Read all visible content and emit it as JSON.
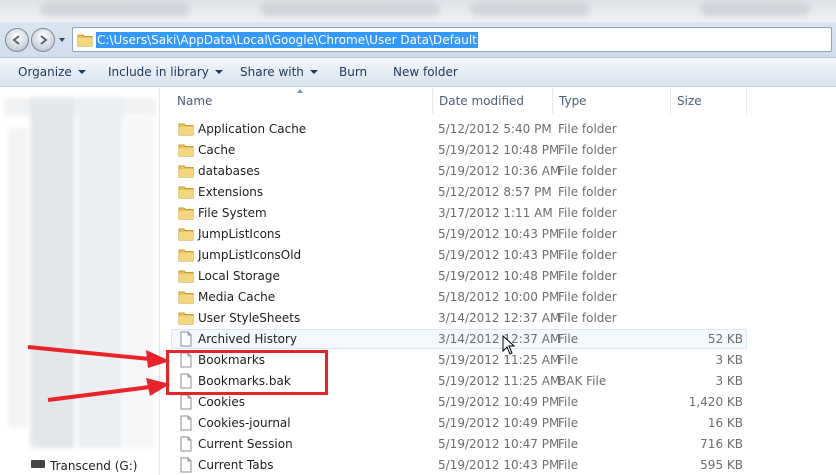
{
  "address_bar": {
    "path": "C:\\Users\\Saki\\AppData\\Local\\Google\\Chrome\\User Data\\Default"
  },
  "toolbar": {
    "organize": "Organize",
    "include_in_library": "Include in library",
    "share_with": "Share with",
    "burn": "Burn",
    "new_folder": "New folder"
  },
  "columns": {
    "name": "Name",
    "date_modified": "Date modified",
    "type": "Type",
    "size": "Size"
  },
  "nav_pane": {
    "drive_label": "Transcend (G:)"
  },
  "files": [
    {
      "name": "Application Cache",
      "date": "5/12/2012 5:40 PM",
      "type": "File folder",
      "size": "",
      "icon": "folder-icon"
    },
    {
      "name": "Cache",
      "date": "5/19/2012 10:48 PM",
      "type": "File folder",
      "size": "",
      "icon": "folder-icon"
    },
    {
      "name": "databases",
      "date": "5/19/2012 10:36 AM",
      "type": "File folder",
      "size": "",
      "icon": "folder-icon"
    },
    {
      "name": "Extensions",
      "date": "5/12/2012 8:57 PM",
      "type": "File folder",
      "size": "",
      "icon": "folder-icon"
    },
    {
      "name": "File System",
      "date": "3/17/2012 1:11 AM",
      "type": "File folder",
      "size": "",
      "icon": "folder-icon"
    },
    {
      "name": "JumpListIcons",
      "date": "5/19/2012 10:43 PM",
      "type": "File folder",
      "size": "",
      "icon": "folder-icon"
    },
    {
      "name": "JumpListIconsOld",
      "date": "5/19/2012 10:43 PM",
      "type": "File folder",
      "size": "",
      "icon": "folder-icon"
    },
    {
      "name": "Local Storage",
      "date": "5/19/2012 10:48 PM",
      "type": "File folder",
      "size": "",
      "icon": "folder-icon"
    },
    {
      "name": "Media Cache",
      "date": "5/18/2012 10:00 PM",
      "type": "File folder",
      "size": "",
      "icon": "folder-icon"
    },
    {
      "name": "User StyleSheets",
      "date": "3/14/2012 12:37 AM",
      "type": "File folder",
      "size": "",
      "icon": "folder-icon"
    },
    {
      "name": "Archived History",
      "date": "3/14/2012 12:37 AM",
      "type": "File",
      "size": "52 KB",
      "icon": "file-icon"
    },
    {
      "name": "Bookmarks",
      "date": "5/19/2012 11:25 AM",
      "type": "File",
      "size": "3 KB",
      "icon": "file-icon"
    },
    {
      "name": "Bookmarks.bak",
      "date": "5/19/2012 11:25 AM",
      "type": "BAK File",
      "size": "3 KB",
      "icon": "file-icon"
    },
    {
      "name": "Cookies",
      "date": "5/19/2012 10:49 PM",
      "type": "File",
      "size": "1,420 KB",
      "icon": "file-icon"
    },
    {
      "name": "Cookies-journal",
      "date": "5/19/2012 10:49 PM",
      "type": "File",
      "size": "16 KB",
      "icon": "file-icon"
    },
    {
      "name": "Current Session",
      "date": "5/19/2012 10:47 PM",
      "type": "File",
      "size": "716 KB",
      "icon": "file-icon"
    },
    {
      "name": "Current Tabs",
      "date": "5/19/2012 10:43 PM",
      "type": "File",
      "size": "595 KB",
      "icon": "file-icon"
    }
  ],
  "colors": {
    "selection": "#3399ff",
    "annotation": "#e8232a",
    "folder": "#e8c15a"
  }
}
